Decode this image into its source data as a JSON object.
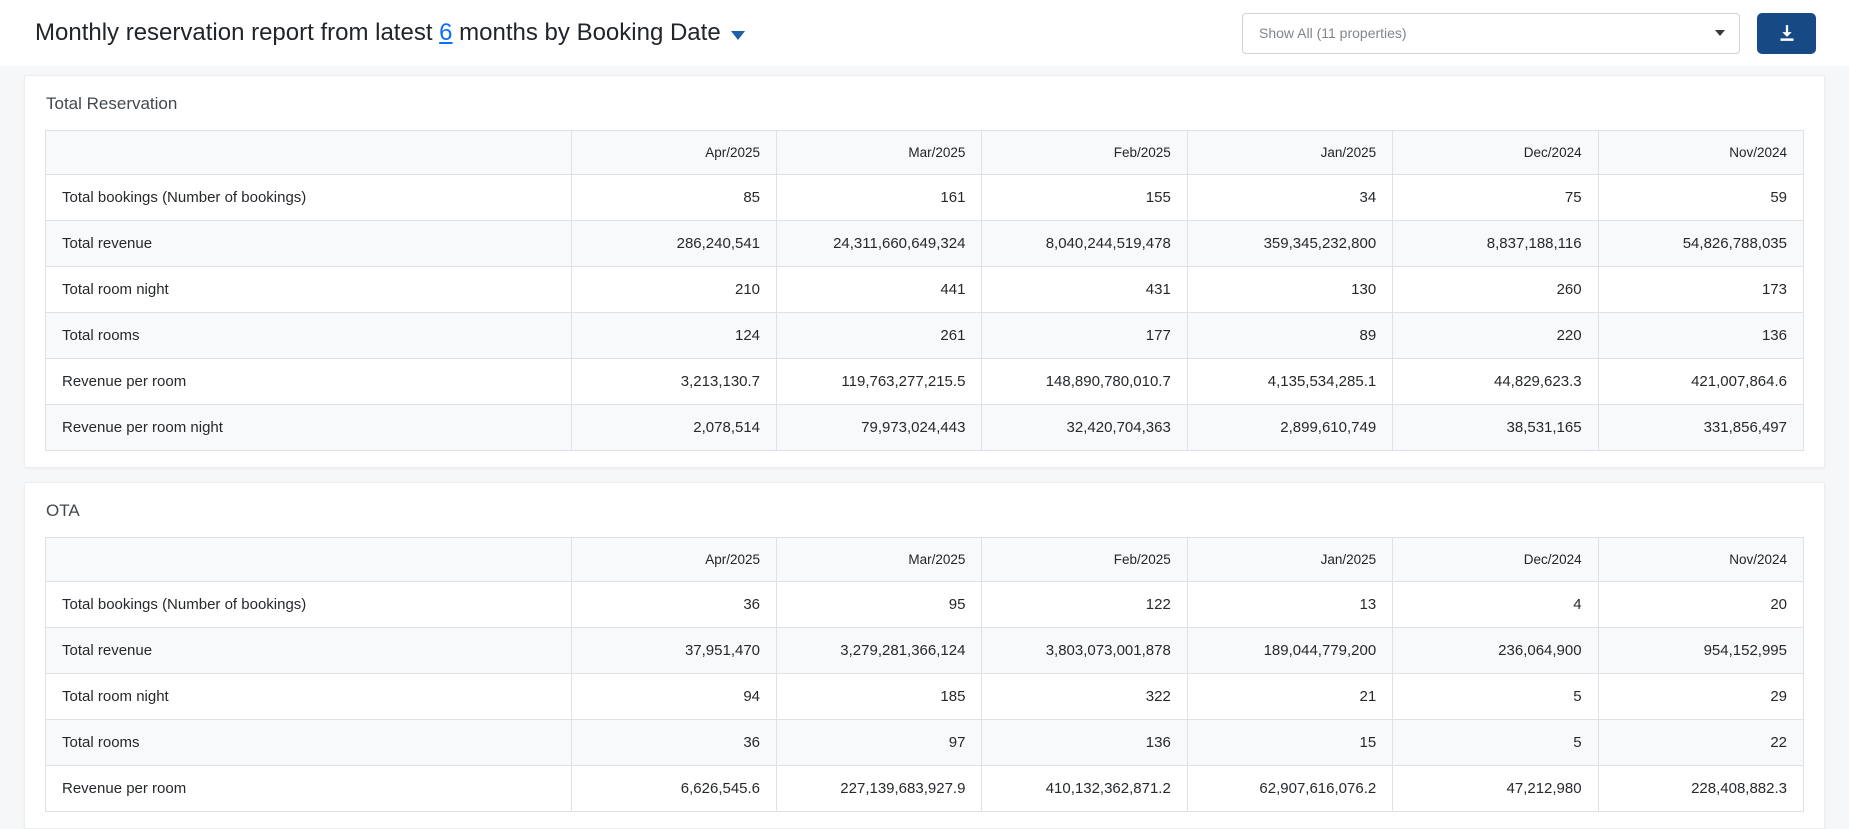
{
  "header": {
    "title_prefix": "Monthly reservation report from latest ",
    "months_count": "6",
    "title_suffix": " months by Booking Date",
    "property_filter_value": "Show All (11 properties)"
  },
  "colors": {
    "link": "#0d6efd",
    "title_caret": "#1f5fa9",
    "download_button": "#174a85"
  },
  "columns": [
    "Apr/2025",
    "Mar/2025",
    "Feb/2025",
    "Jan/2025",
    "Dec/2024",
    "Nov/2024"
  ],
  "sections": [
    {
      "title": "Total Reservation",
      "rows": [
        {
          "label": "Total bookings (Number of bookings)",
          "values": [
            "85",
            "161",
            "155",
            "34",
            "75",
            "59"
          ]
        },
        {
          "label": "Total revenue",
          "values": [
            "286,240,541",
            "24,311,660,649,324",
            "8,040,244,519,478",
            "359,345,232,800",
            "8,837,188,116",
            "54,826,788,035"
          ]
        },
        {
          "label": "Total room night",
          "values": [
            "210",
            "441",
            "431",
            "130",
            "260",
            "173"
          ]
        },
        {
          "label": "Total rooms",
          "values": [
            "124",
            "261",
            "177",
            "89",
            "220",
            "136"
          ]
        },
        {
          "label": "Revenue per room",
          "values": [
            "3,213,130.7",
            "119,763,277,215.5",
            "148,890,780,010.7",
            "4,135,534,285.1",
            "44,829,623.3",
            "421,007,864.6"
          ]
        },
        {
          "label": "Revenue per room night",
          "values": [
            "2,078,514",
            "79,973,024,443",
            "32,420,704,363",
            "2,899,610,749",
            "38,531,165",
            "331,856,497"
          ]
        }
      ]
    },
    {
      "title": "OTA",
      "rows": [
        {
          "label": "Total bookings (Number of bookings)",
          "values": [
            "36",
            "95",
            "122",
            "13",
            "4",
            "20"
          ]
        },
        {
          "label": "Total revenue",
          "values": [
            "37,951,470",
            "3,279,281,366,124",
            "3,803,073,001,878",
            "189,044,779,200",
            "236,064,900",
            "954,152,995"
          ]
        },
        {
          "label": "Total room night",
          "values": [
            "94",
            "185",
            "322",
            "21",
            "5",
            "29"
          ]
        },
        {
          "label": "Total rooms",
          "values": [
            "36",
            "97",
            "136",
            "15",
            "5",
            "22"
          ]
        },
        {
          "label": "Revenue per room",
          "values": [
            "6,626,545.6",
            "227,139,683,927.9",
            "410,132,362,871.2",
            "62,907,616,076.2",
            "47,212,980",
            "228,408,882.3"
          ]
        }
      ]
    }
  ]
}
